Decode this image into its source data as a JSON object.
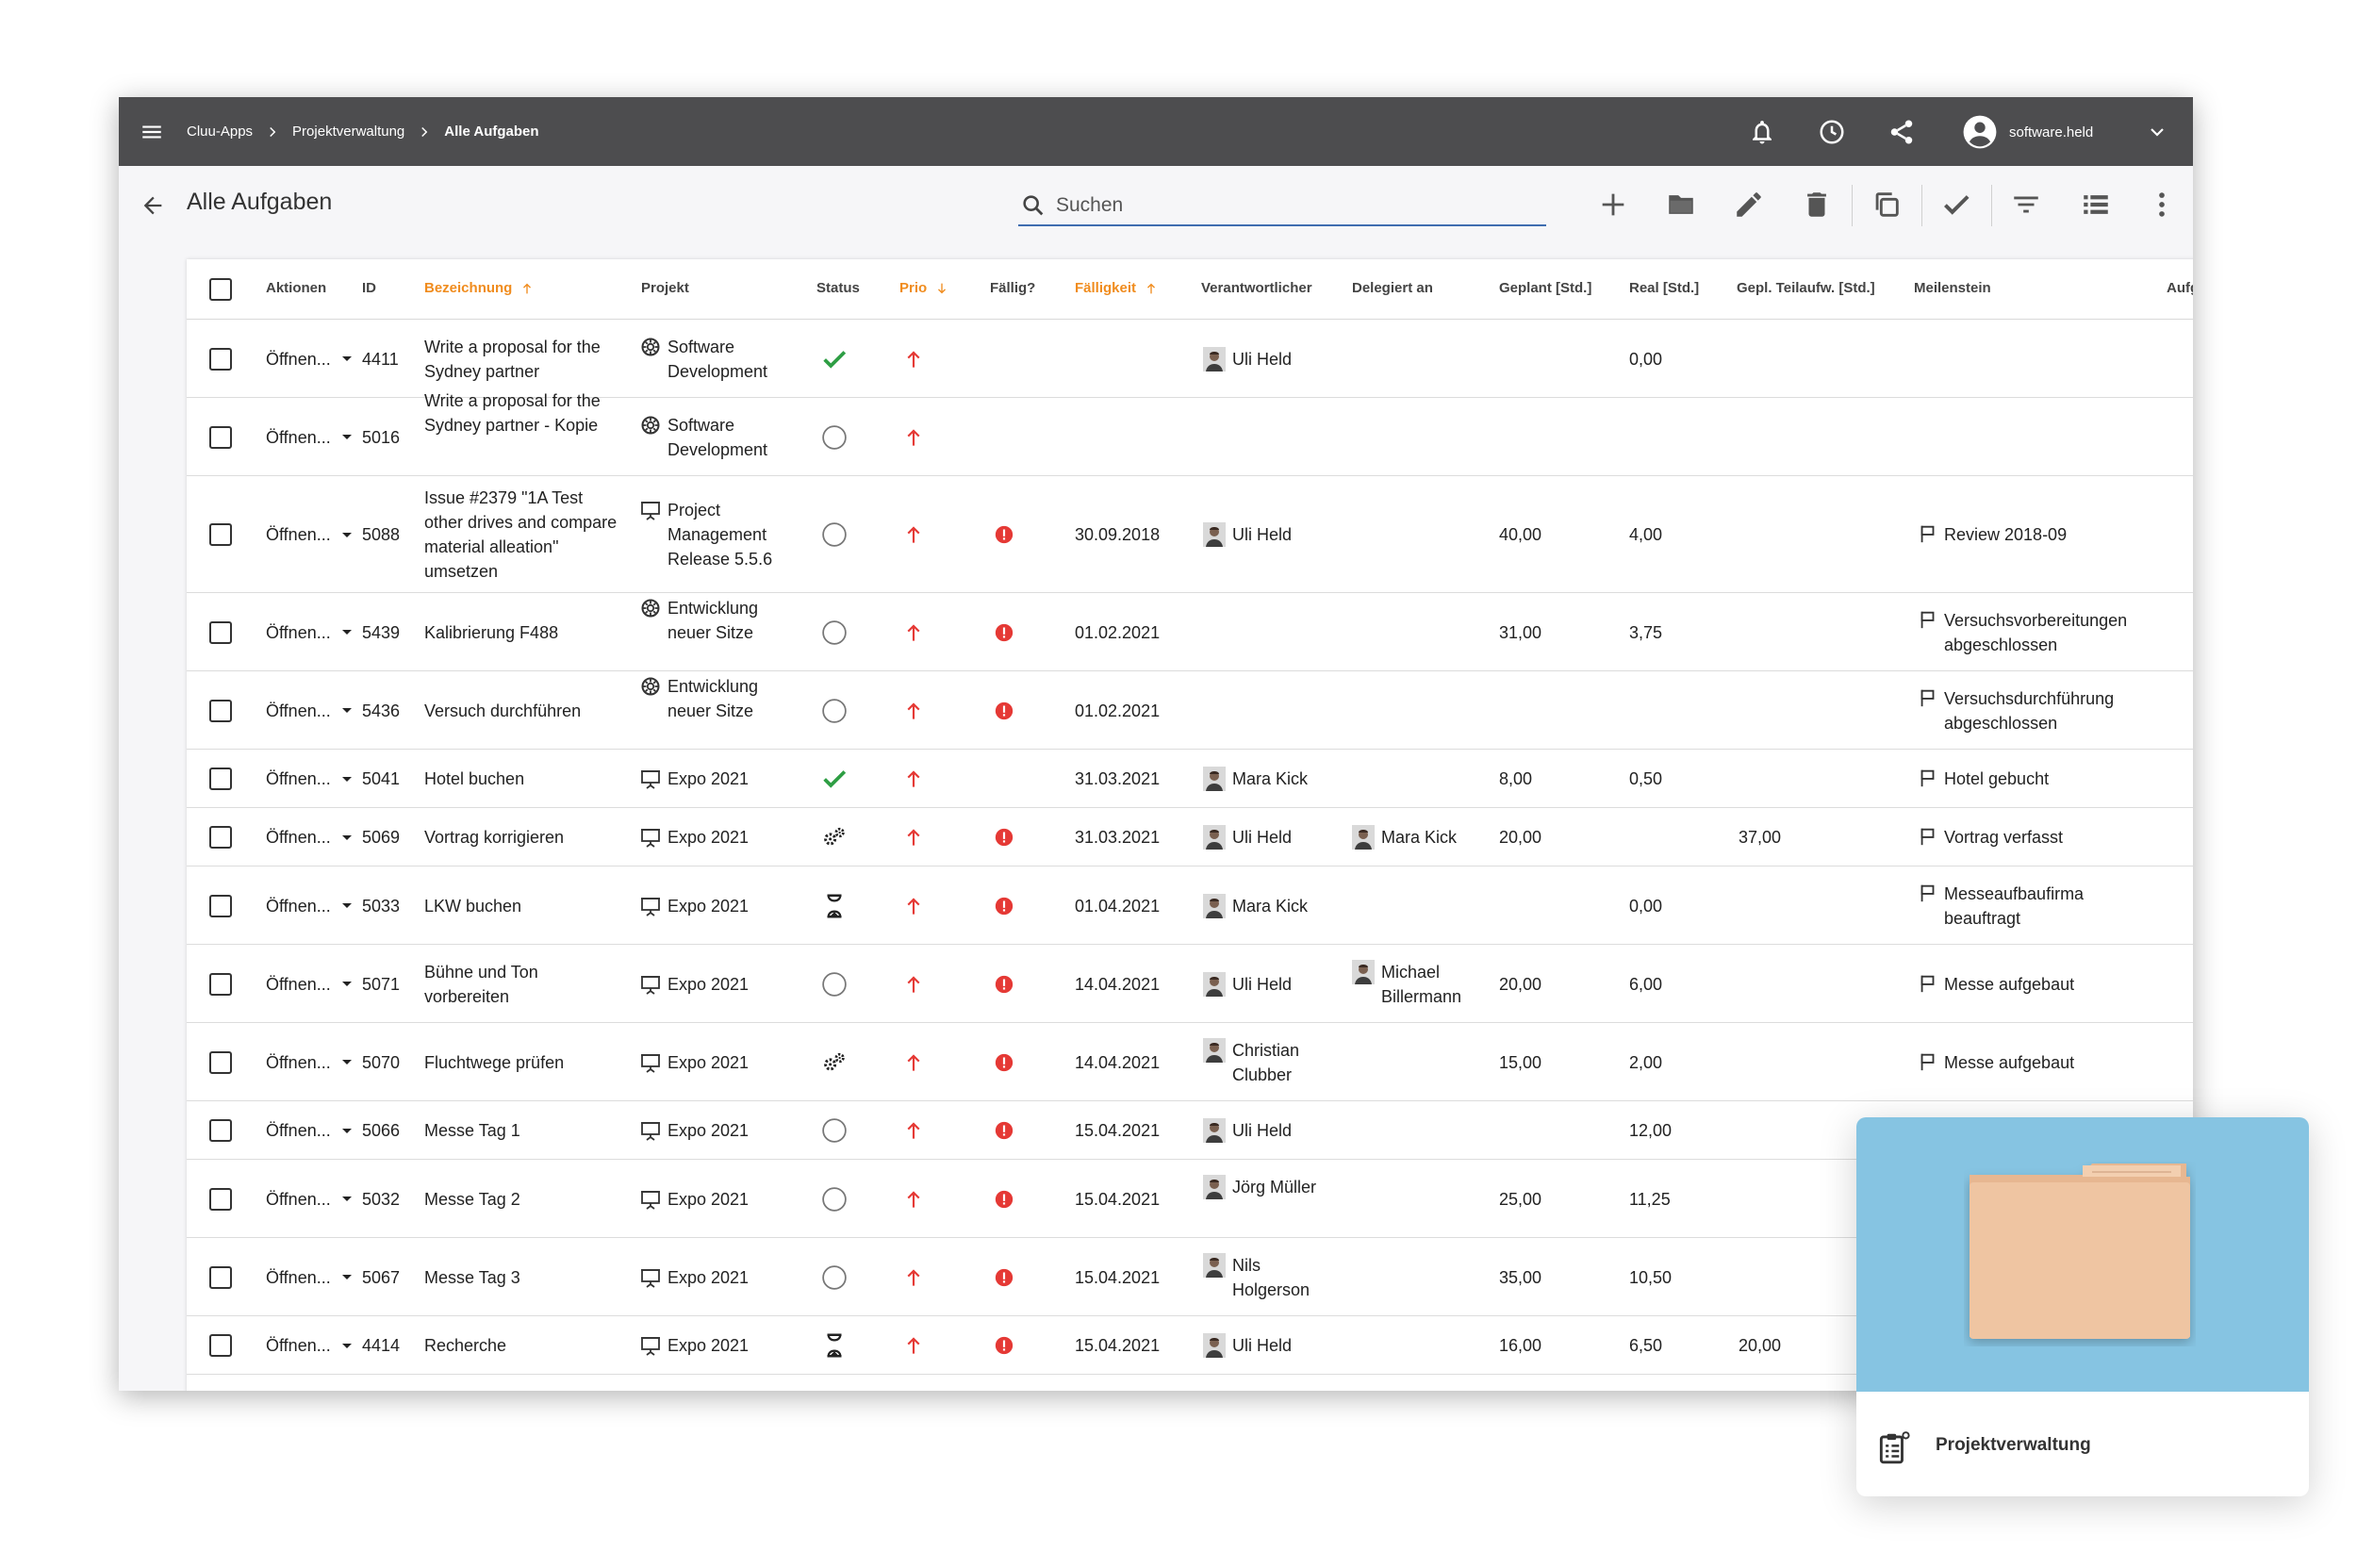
{
  "breadcrumb": [
    "Cluu-Apps",
    "Projektverwaltung",
    "Alle Aufgaben"
  ],
  "user": {
    "name": "software.held"
  },
  "page": {
    "title": "Alle Aufgaben"
  },
  "search": {
    "placeholder": "Suchen",
    "value": ""
  },
  "toolbar_icons": [
    "add-icon",
    "folder-icon",
    "edit-icon",
    "delete-icon",
    "copy-icon",
    "check-icon",
    "filter-icon",
    "list-view-icon",
    "more-vert-icon"
  ],
  "topbar_icons": [
    "bell-icon",
    "clock-icon",
    "share-icon",
    "account-circle-icon",
    "chevron-down-icon"
  ],
  "colors": {
    "topbar": "#4d4d4f",
    "sorted_header": "#f08c1e",
    "accent_line": "#3f6db0",
    "ok_green": "#2e9e44",
    "prio_red": "#e53935",
    "overlay_blue": "#86c4e2"
  },
  "table": {
    "columns": [
      "Aktionen",
      "ID",
      "Bezeichnung",
      "Projekt",
      "Status",
      "Prio",
      "Fällig?",
      "Fälligkeit",
      "Verantwortlicher",
      "Delegiert an",
      "Geplant [Std.]",
      "Real [Std.]",
      "Gepl. Teilaufw. [Std.]",
      "Meilenstein",
      "Aufg"
    ],
    "sorted_columns": {
      "Bezeichnung": "up",
      "Prio": "down",
      "Fälligkeit": "up"
    },
    "rows": [
      {
        "action": "Öffnen...",
        "id": "4411",
        "name": "Write a proposal for the Sydney partner",
        "project": "Software Development",
        "project_icon": "gear-project-icon",
        "status": "done",
        "prio": "high",
        "overdue": false,
        "due": "",
        "responsible": "Uli Held",
        "delegated": "",
        "planned": "",
        "real": "0,00",
        "partial": "",
        "milestone": ""
      },
      {
        "action": "Öffnen...",
        "id": "5016",
        "name": "Write a proposal for the Sydney partner  - Kopie",
        "project": "Software Development",
        "project_icon": "gear-project-icon",
        "status": "open",
        "prio": "high",
        "overdue": false,
        "due": "",
        "responsible": "",
        "delegated": "",
        "planned": "",
        "real": "",
        "partial": "",
        "milestone": ""
      },
      {
        "action": "Öffnen...",
        "id": "5088",
        "name": "Issue #2379 \"1A Test other drives and compare material alleation\" umsetzen",
        "project": "Project Management Release 5.5.6",
        "project_icon": "presentation-icon",
        "status": "open",
        "prio": "high",
        "overdue": true,
        "due": "30.09.2018",
        "responsible": "Uli Held",
        "delegated": "",
        "planned": "40,00",
        "real": "4,00",
        "partial": "",
        "milestone": "Review 2018-09"
      },
      {
        "action": "Öffnen...",
        "id": "5439",
        "name": "Kalibrierung F488",
        "project": "Entwicklung neuer Sitze",
        "project_icon": "gear-project-icon",
        "status": "open",
        "prio": "high",
        "overdue": true,
        "due": "01.02.2021",
        "responsible": "",
        "delegated": "",
        "planned": "31,00",
        "real": "3,75",
        "partial": "",
        "milestone": "Versuchsvorbereitungen abgeschlossen"
      },
      {
        "action": "Öffnen...",
        "id": "5436",
        "name": "Versuch durchführen",
        "project": "Entwicklung neuer Sitze",
        "project_icon": "gear-project-icon",
        "status": "open",
        "prio": "high",
        "overdue": true,
        "due": "01.02.2021",
        "responsible": "",
        "delegated": "",
        "planned": "",
        "real": "",
        "partial": "",
        "milestone": "Versuchsdurchführung abgeschlossen"
      },
      {
        "action": "Öffnen...",
        "id": "5041",
        "name": "Hotel buchen",
        "project": "Expo 2021",
        "project_icon": "presentation-icon",
        "status": "done",
        "prio": "high",
        "overdue": false,
        "due": "31.03.2021",
        "responsible": "Mara Kick",
        "delegated": "",
        "planned": "8,00",
        "real": "0,50",
        "partial": "",
        "milestone": "Hotel gebucht"
      },
      {
        "action": "Öffnen...",
        "id": "5069",
        "name": "Vortrag korrigieren",
        "project": "Expo 2021",
        "project_icon": "presentation-icon",
        "status": "in-progress",
        "prio": "high",
        "overdue": true,
        "due": "31.03.2021",
        "responsible": "Uli Held",
        "delegated": "Mara Kick",
        "planned": "20,00",
        "real": "",
        "partial": "37,00",
        "milestone": "Vortrag verfasst"
      },
      {
        "action": "Öffnen...",
        "id": "5033",
        "name": "LKW buchen",
        "project": "Expo 2021",
        "project_icon": "presentation-icon",
        "status": "waiting",
        "prio": "high",
        "overdue": true,
        "due": "01.04.2021",
        "responsible": "Mara Kick",
        "delegated": "",
        "planned": "",
        "real": "0,00",
        "partial": "",
        "milestone": "Messeaufbaufirma beauftragt"
      },
      {
        "action": "Öffnen...",
        "id": "5071",
        "name": "Bühne und Ton vorbereiten",
        "project": "Expo 2021",
        "project_icon": "presentation-icon",
        "status": "open",
        "prio": "high",
        "overdue": true,
        "due": "14.04.2021",
        "responsible": "Uli Held",
        "delegated": "Michael Billermann",
        "planned": "20,00",
        "real": "6,00",
        "partial": "",
        "milestone": "Messe aufgebaut"
      },
      {
        "action": "Öffnen...",
        "id": "5070",
        "name": "Fluchtwege prüfen",
        "project": "Expo 2021",
        "project_icon": "presentation-icon",
        "status": "in-progress",
        "prio": "high",
        "overdue": true,
        "due": "14.04.2021",
        "responsible": "Christian Clubber",
        "delegated": "",
        "planned": "15,00",
        "real": "2,00",
        "partial": "",
        "milestone": "Messe aufgebaut"
      },
      {
        "action": "Öffnen...",
        "id": "5066",
        "name": "Messe Tag 1",
        "project": "Expo 2021",
        "project_icon": "presentation-icon",
        "status": "open",
        "prio": "high",
        "overdue": true,
        "due": "15.04.2021",
        "responsible": "Uli Held",
        "delegated": "",
        "planned": "",
        "real": "12,00",
        "partial": "",
        "milestone": ""
      },
      {
        "action": "Öffnen...",
        "id": "5032",
        "name": "Messe Tag 2",
        "project": "Expo 2021",
        "project_icon": "presentation-icon",
        "status": "open",
        "prio": "high",
        "overdue": true,
        "due": "15.04.2021",
        "responsible": "Jörg Müller",
        "delegated": "",
        "planned": "25,00",
        "real": "11,25",
        "partial": "",
        "milestone": ""
      },
      {
        "action": "Öffnen...",
        "id": "5067",
        "name": "Messe Tag 3",
        "project": "Expo 2021",
        "project_icon": "presentation-icon",
        "status": "open",
        "prio": "high",
        "overdue": true,
        "due": "15.04.2021",
        "responsible": "Nils Holgerson",
        "delegated": "",
        "planned": "35,00",
        "real": "10,50",
        "partial": "",
        "milestone": ""
      },
      {
        "action": "Öffnen...",
        "id": "4414",
        "name": "Recherche",
        "project": "Expo 2021",
        "project_icon": "presentation-icon",
        "status": "waiting",
        "prio": "high",
        "overdue": true,
        "due": "15.04.2021",
        "responsible": "Uli Held",
        "delegated": "",
        "planned": "16,00",
        "real": "6,50",
        "partial": "20,00",
        "milestone": ""
      }
    ]
  },
  "app_card": {
    "label": "Projektverwaltung",
    "icon": "clipboard-icon"
  }
}
